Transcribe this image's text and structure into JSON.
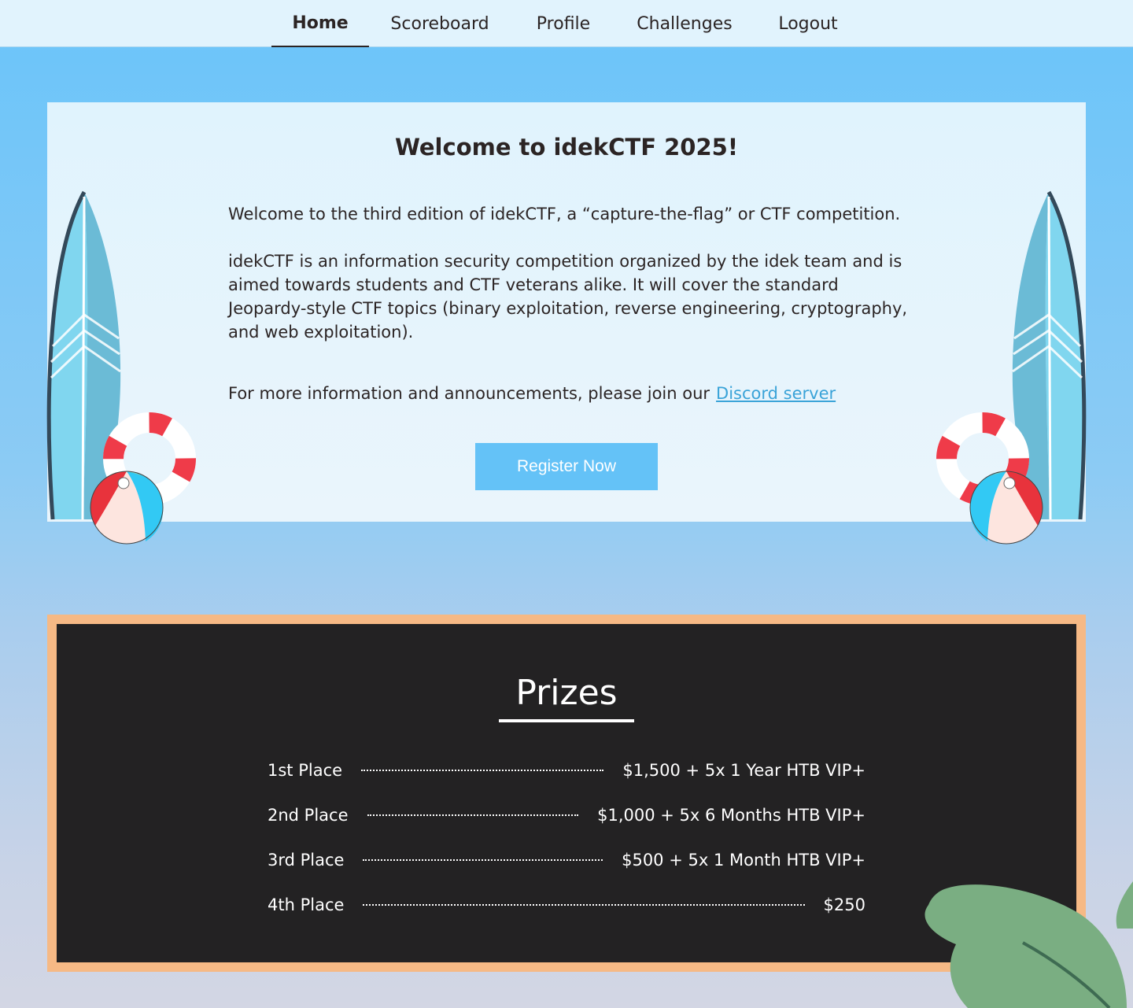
{
  "nav": {
    "items": [
      {
        "label": "Home",
        "active": true
      },
      {
        "label": "Scoreboard"
      },
      {
        "label": "Profile"
      },
      {
        "label": "Challenges"
      },
      {
        "label": "Logout"
      }
    ]
  },
  "welcome": {
    "title": "Welcome to idekCTF 2025!",
    "intro": "Welcome to the third edition of idekCTF, a “capture-the-flag” or CTF competition.",
    "description": "idekCTF is an information security competition organized by the idek team and is aimed towards students and CTF veterans alike. It will cover the standard Jeopardy-style CTF topics (binary exploitation, reverse engineering, cryptography, and web exploitation).",
    "more_info": "For more information and announcements, please join our",
    "discord_link": "Discord server",
    "register_button": "Register Now"
  },
  "prizes": {
    "title": "Prizes",
    "rows": [
      {
        "place": "1st Place",
        "prize": "$1,500 + 5x 1 Year HTB VIP+"
      },
      {
        "place": "2nd Place",
        "prize": "$1,000 + 5x 6 Months HTB VIP+"
      },
      {
        "place": "3rd Place",
        "prize": "$500 + 5x 1 Month HTB VIP+"
      },
      {
        "place": "4th Place",
        "prize": "$250"
      }
    ]
  },
  "colors": {
    "nav_bg": "#e1f3fd",
    "accent_blue": "#64c2f7",
    "link": "#3aa3d8",
    "board": "#232223",
    "frame": "#f6b985",
    "text": "#2b2424"
  }
}
